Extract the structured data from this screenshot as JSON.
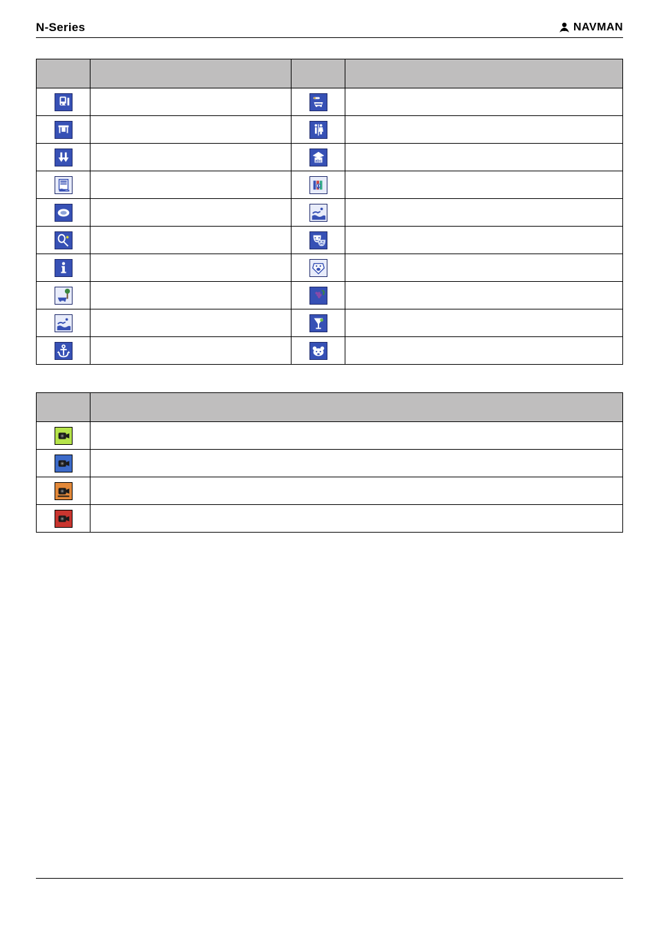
{
  "header": {
    "series": "N-Series",
    "brand": "NAVMAN"
  },
  "table1": {
    "header": {
      "c0": "",
      "c1": "",
      "c2": "",
      "c3": ""
    },
    "rows": [
      {
        "iconA": "bus-station",
        "labelA": "",
        "iconB": "car-facility",
        "labelB": ""
      },
      {
        "iconA": "bus-stop",
        "labelA": "",
        "iconB": "restroom",
        "labelB": ""
      },
      {
        "iconA": "arrows-down",
        "labelA": "",
        "iconB": "school",
        "labelB": ""
      },
      {
        "iconA": "document",
        "labelA": "",
        "iconB": "library",
        "labelB": ""
      },
      {
        "iconA": "stadium",
        "labelA": "",
        "iconB": "swimming",
        "labelB": ""
      },
      {
        "iconA": "tennis",
        "labelA": "",
        "iconB": "theatre",
        "labelB": ""
      },
      {
        "iconA": "info-i",
        "labelA": "",
        "iconB": "vet",
        "labelB": ""
      },
      {
        "iconA": "scenic-drive",
        "labelA": "",
        "iconB": "winery",
        "labelB": ""
      },
      {
        "iconA": "water-light",
        "labelA": "",
        "iconB": "bar",
        "labelB": ""
      },
      {
        "iconA": "anchor",
        "labelA": "",
        "iconB": "zoo",
        "labelB": ""
      }
    ]
  },
  "table2": {
    "header": {
      "c0": "",
      "c1": ""
    },
    "rows": [
      {
        "icon": "camera-green",
        "label": ""
      },
      {
        "icon": "camera-blue",
        "label": ""
      },
      {
        "icon": "camera-orange",
        "label": ""
      },
      {
        "icon": "camera-red",
        "label": ""
      }
    ]
  },
  "footer": {
    "page": ""
  }
}
